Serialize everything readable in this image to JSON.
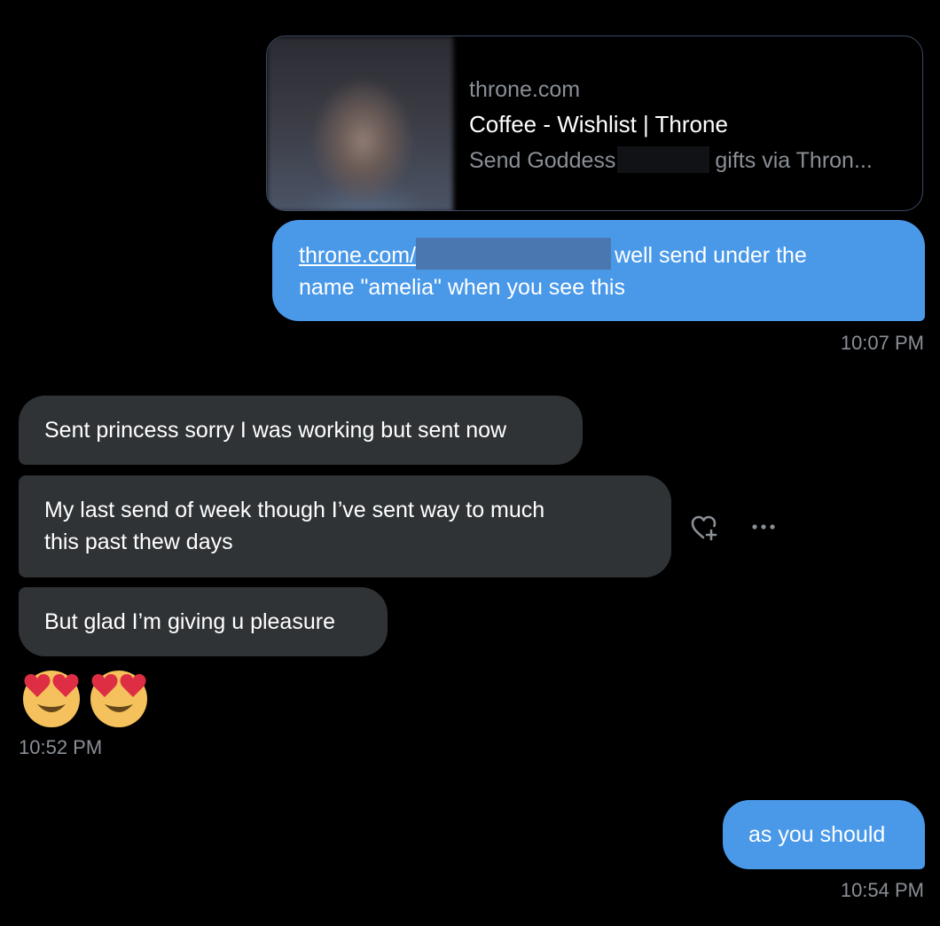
{
  "link_preview": {
    "domain": "throne.com",
    "title": "Coffee - Wishlist | Throne",
    "description_start": "Send Goddess",
    "description_end": "gifts via Thron..."
  },
  "messages": {
    "outgoing_1": {
      "link_text": "throne.com/",
      "text_line1": "well send under the",
      "text_line2": "name \"amelia\" when you see this",
      "time": "10:07 PM"
    },
    "incoming": [
      {
        "text": "Sent princess sorry I was working but sent now"
      },
      {
        "text_line1": "My last send of week though I’ve sent way to much",
        "text_line2": "this past thew days"
      },
      {
        "text": "But glad I’m giving u pleasure"
      }
    ],
    "incoming_emoji": [
      "heart-eyes-emoji",
      "heart-eyes-emoji"
    ],
    "incoming_time": "10:52 PM",
    "outgoing_2": {
      "text": "as you should",
      "time": "10:54 PM"
    }
  },
  "icons": {
    "react": "heart-plus-icon",
    "more": "more-options-icon"
  },
  "colors": {
    "background": "#000000",
    "outgoing_bubble": "#4a99e9",
    "incoming_bubble": "#2f3336",
    "muted_text": "#8a8f96"
  }
}
